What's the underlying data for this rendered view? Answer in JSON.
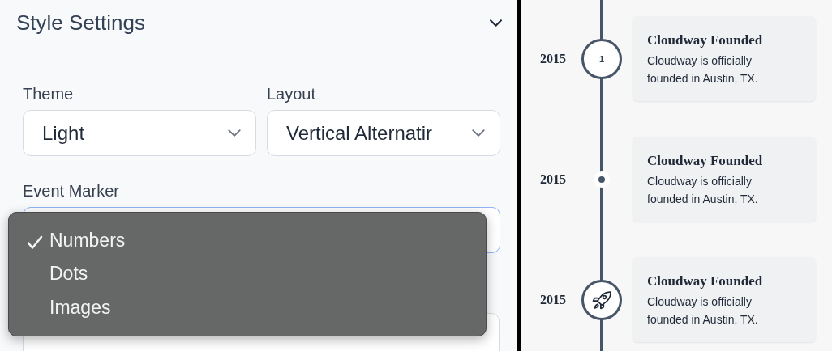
{
  "panel": {
    "title": "Style Settings",
    "expanded": true
  },
  "fields": [
    {
      "label": "Theme",
      "value": "Light"
    },
    {
      "label": "Layout",
      "value": "Vertical Alternatir"
    }
  ],
  "event_marker": {
    "label": "Event Marker",
    "focused": true,
    "options": [
      {
        "label": "Numbers",
        "selected": true
      },
      {
        "label": "Dots",
        "selected": false
      },
      {
        "label": "Images",
        "selected": false
      }
    ]
  },
  "timeline": [
    {
      "year": "2015",
      "kind": "number",
      "marker_text": "1",
      "title": "Cloudway Founded",
      "body": "Cloudway is officially founded in Austin, TX."
    },
    {
      "year": "2015",
      "kind": "dot",
      "title": "Cloudway Founded",
      "body": "Cloudway is officially founded in Austin, TX."
    },
    {
      "year": "2015",
      "kind": "image",
      "title": "Cloudway Founded",
      "body": "Cloudway is officially founded in Austin, TX."
    }
  ]
}
